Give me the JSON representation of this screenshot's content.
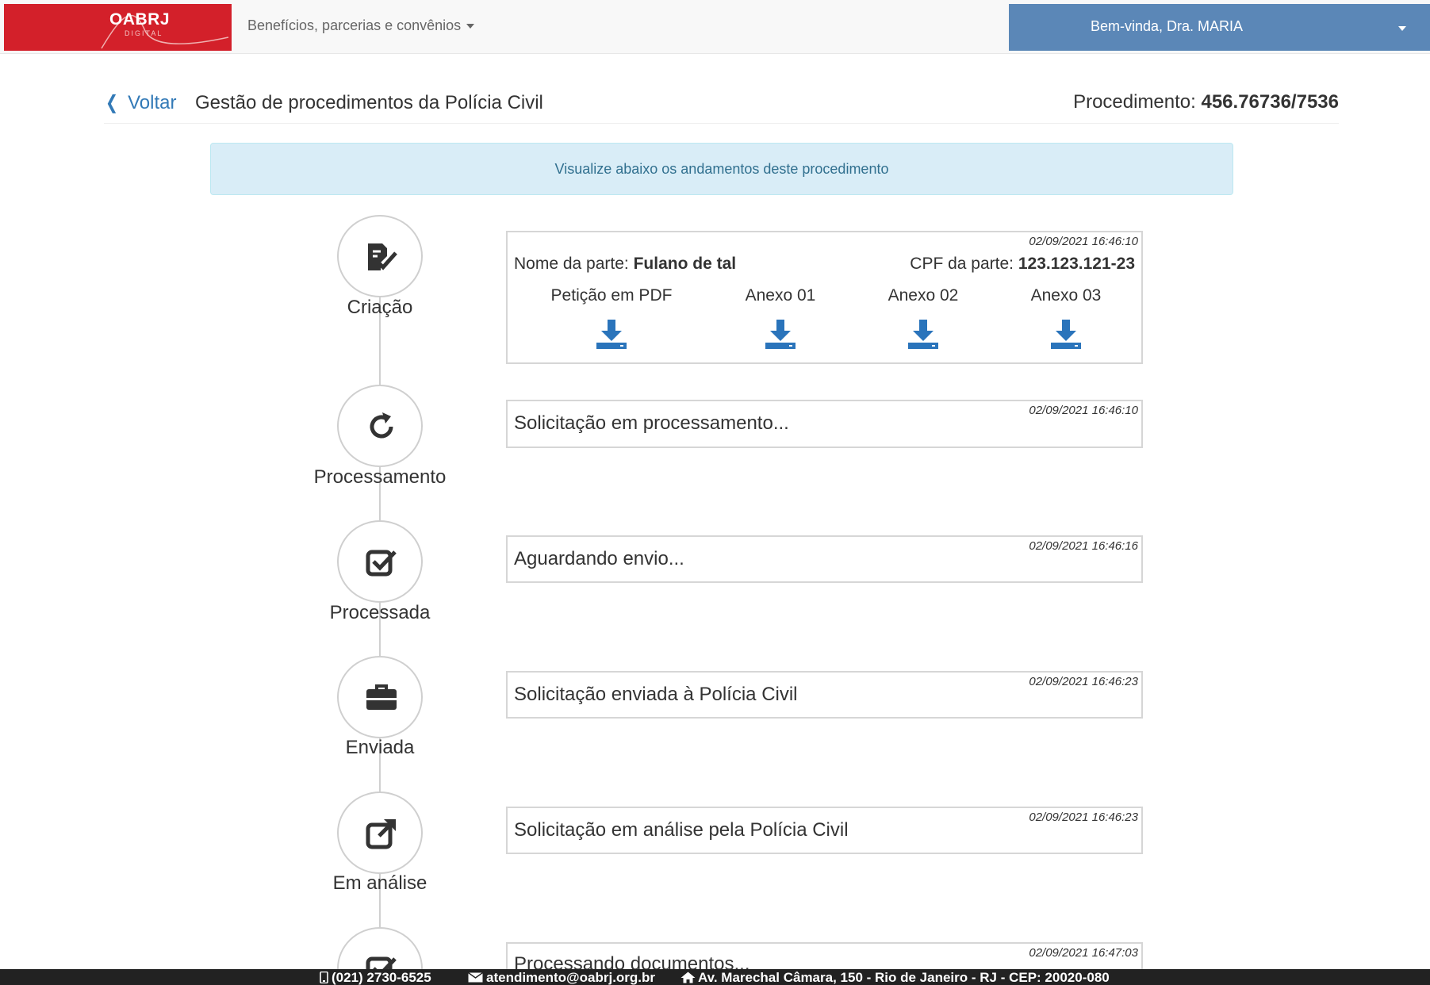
{
  "navbar": {
    "logo_text": "OABRJ",
    "logo_sub": "DIGITAL",
    "menu_label": "Benefícios, parcerias e convênios",
    "user_label": "Bem-vinda, Dra. MARIA"
  },
  "header": {
    "back_label": "Voltar",
    "title": "Gestão de procedimentos da Polícia Civil",
    "proc_prefix": "Procedimento:",
    "proc_number": "456.76736/7536"
  },
  "alert": {
    "text": "Visualize abaixo os andamentos deste procedimento"
  },
  "steps": [
    {
      "label": "Criação",
      "icon": "file-signature-icon"
    },
    {
      "label": "Processamento",
      "icon": "refresh-icon"
    },
    {
      "label": "Processada",
      "icon": "check-square-icon"
    },
    {
      "label": "Enviada",
      "icon": "briefcase-icon"
    },
    {
      "label": "Em análise",
      "icon": "external-link-icon"
    },
    {
      "label": "",
      "icon": "check-square-icon"
    }
  ],
  "cards": [
    {
      "time": "02/09/2021 16:46:10",
      "party_name_label": "Nome da parte:",
      "party_name": "Fulano de tal",
      "party_cpf_label": "CPF da parte:",
      "party_cpf": "123.123.121-23",
      "attachments": [
        "Petição em PDF",
        "Anexo 01",
        "Anexo 02",
        "Anexo 03"
      ]
    },
    {
      "time": "02/09/2021 16:46:10",
      "text": "Solicitação em processamento..."
    },
    {
      "time": "02/09/2021 16:46:16",
      "text": "Aguardando envio..."
    },
    {
      "time": "02/09/2021 16:46:23",
      "text": "Solicitação enviada à Polícia Civil"
    },
    {
      "time": "02/09/2021 16:46:23",
      "text": "Solicitação em análise pela Polícia Civil"
    },
    {
      "time": "02/09/2021 16:47:03",
      "text": "Processando documentos..."
    }
  ],
  "footer": {
    "phone": "(021) 2730-6525",
    "email": "atendimento@oabrj.org.br",
    "address": "Av. Marechal Câmara, 150 - Rio de Janeiro - RJ - CEP: 20020-080"
  },
  "colors": {
    "brand_red": "#d3202a",
    "user_blue": "#5b87b7",
    "link_blue": "#337ab7",
    "download_blue": "#2a74bb",
    "alert_bg": "#d9edf7",
    "alert_text": "#31708f"
  }
}
